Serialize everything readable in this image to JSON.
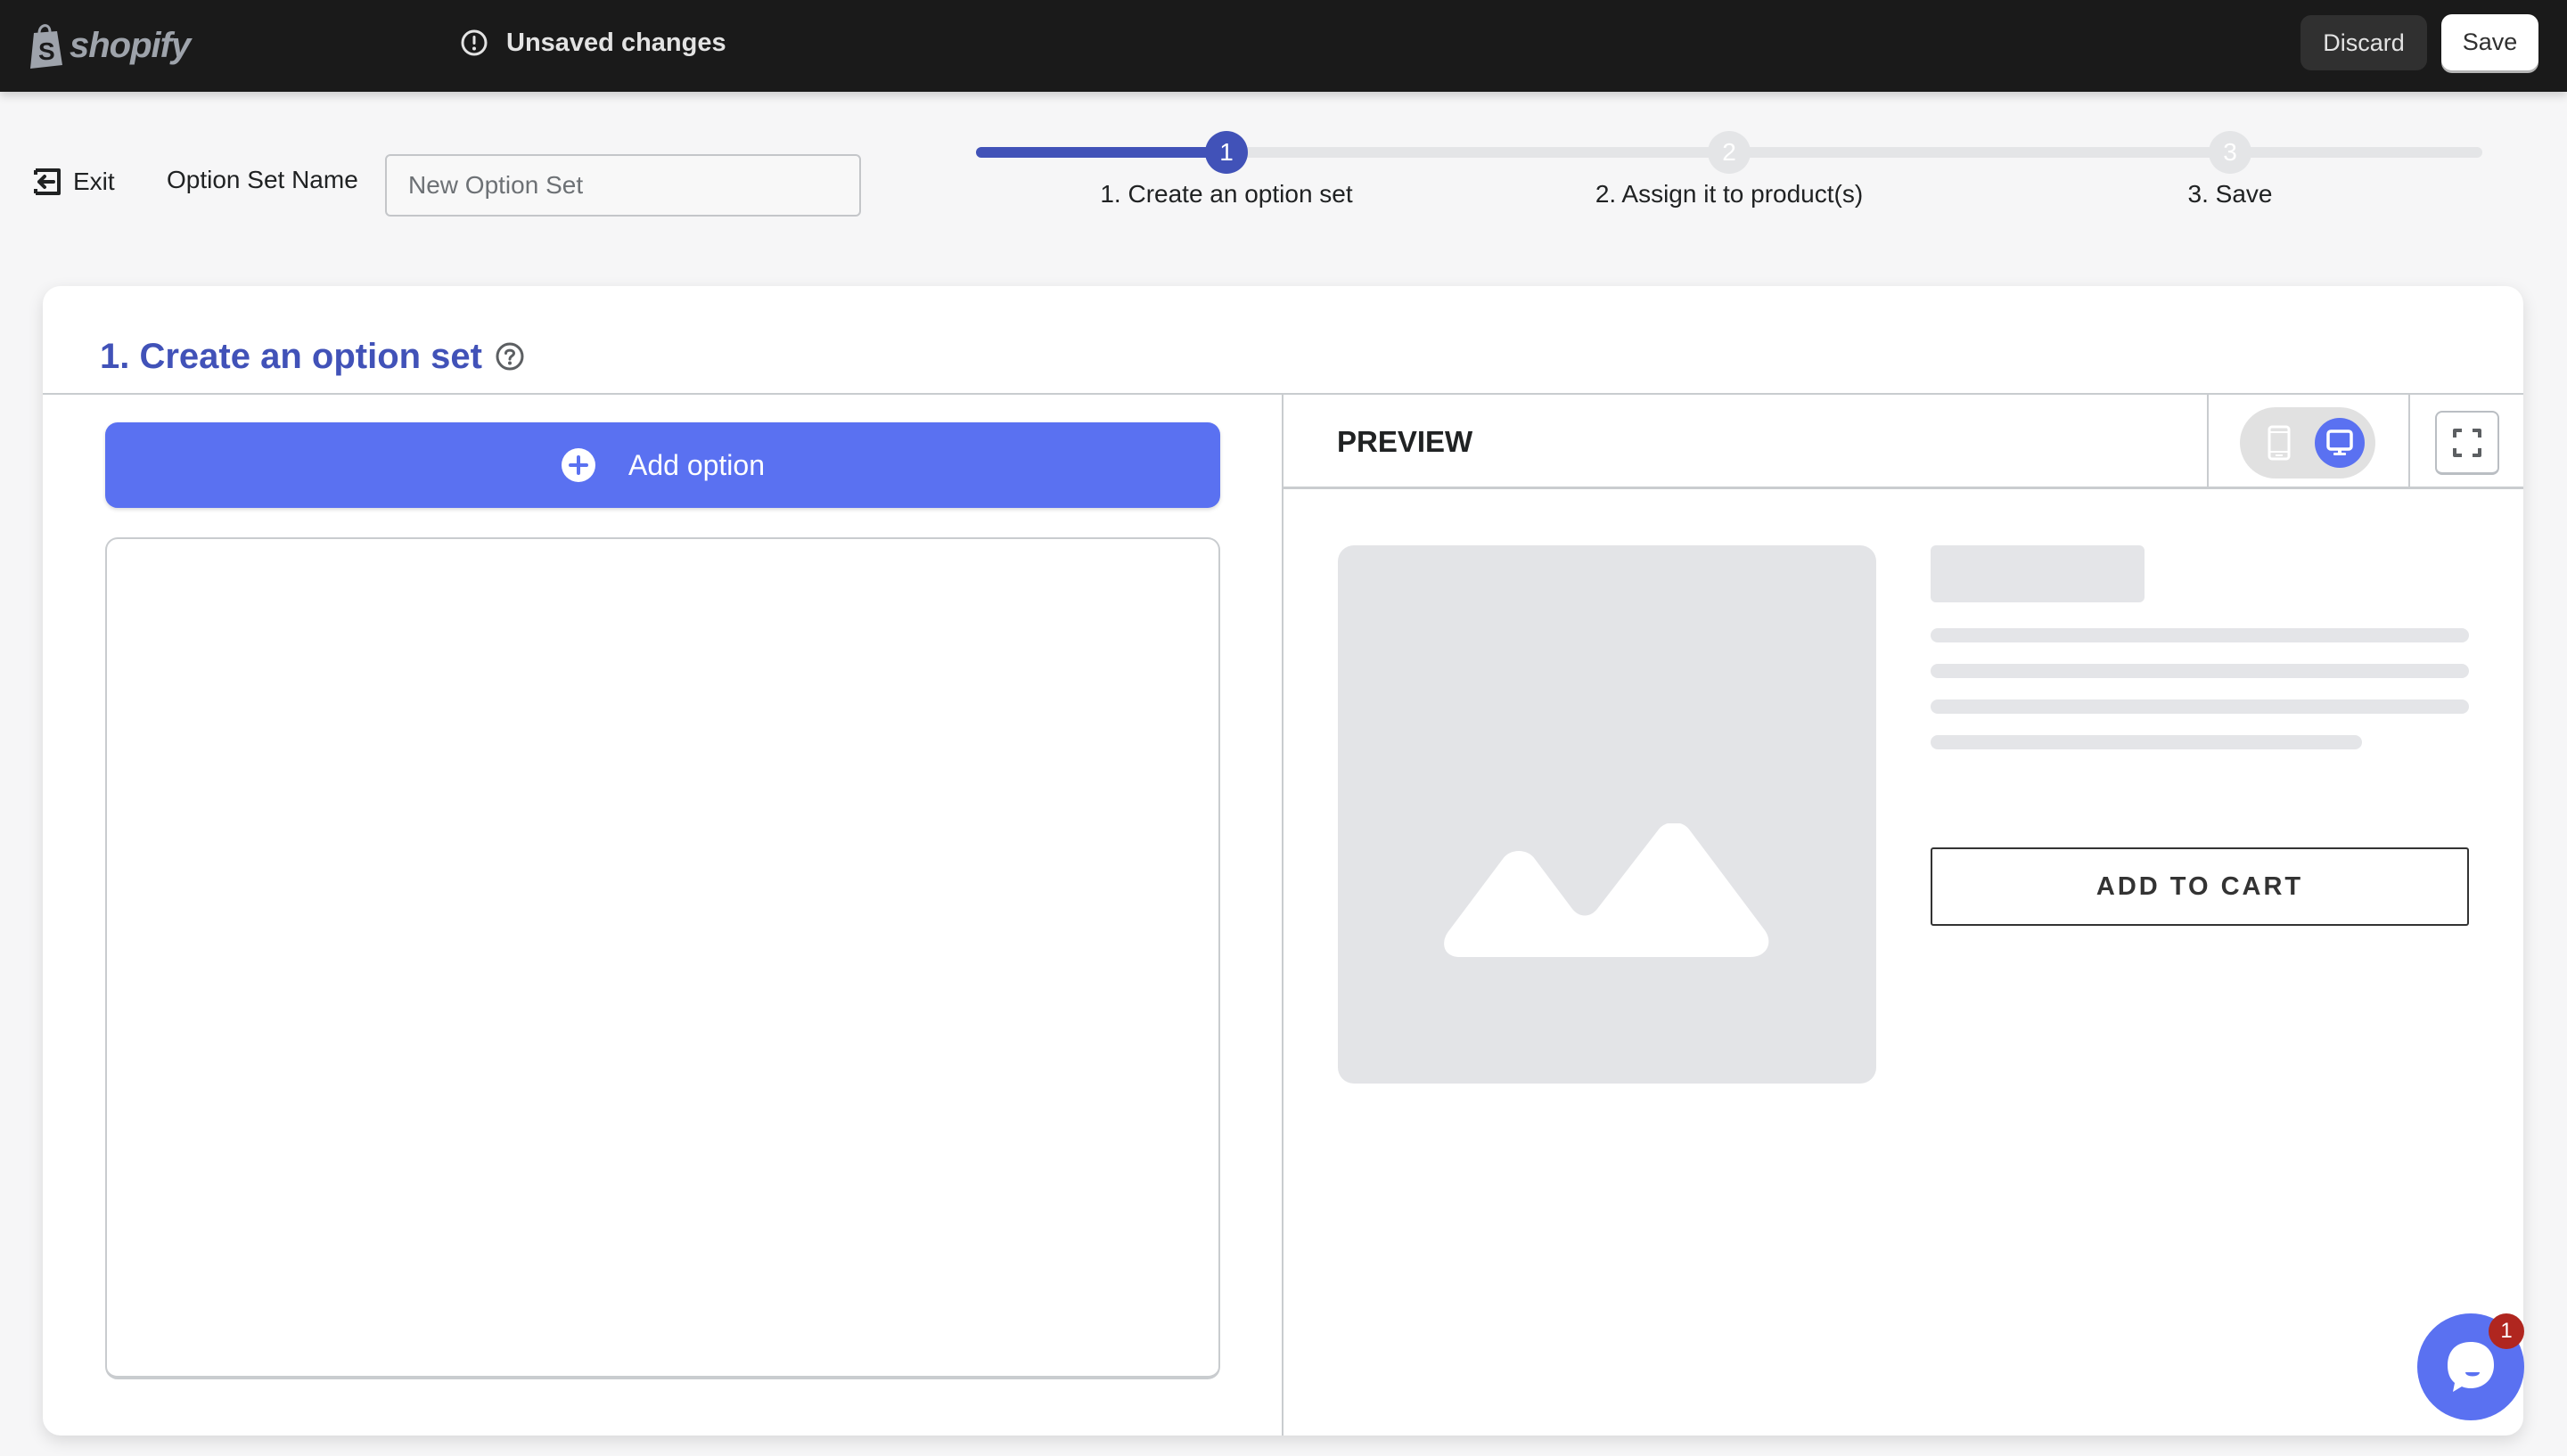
{
  "topbar": {
    "logo_text": "shopify",
    "status_icon": "alert-circle-icon",
    "status_text": "Unsaved changes",
    "discard_label": "Discard",
    "save_label": "Save"
  },
  "subheader": {
    "exit_label": "Exit",
    "exit_icon": "exit-arrow-icon",
    "option_set_name_label": "Option Set Name",
    "option_set_name_value": "",
    "option_set_name_placeholder": "New Option Set"
  },
  "stepper": {
    "progress_fraction": 0.17,
    "steps": [
      {
        "number": "1",
        "label": "1. Create an option set",
        "active": true
      },
      {
        "number": "2",
        "label": "2. Assign it to product(s)",
        "active": false
      },
      {
        "number": "3",
        "label": "3. Save",
        "active": false
      }
    ]
  },
  "card": {
    "title": "1. Create an option set",
    "help_icon": "question-circle-icon",
    "add_option_label": "Add option",
    "add_option_icon": "plus-circle-icon"
  },
  "preview": {
    "title": "PREVIEW",
    "view_modes": [
      {
        "name": "mobile",
        "icon": "mobile-icon",
        "selected": false
      },
      {
        "name": "desktop",
        "icon": "desktop-icon",
        "selected": true
      }
    ],
    "fullscreen_icon": "fullscreen-icon",
    "image_placeholder_icon": "image-placeholder-icon",
    "add_to_cart_label": "ADD TO CART"
  },
  "chat": {
    "icon": "chat-bubble-icon",
    "badge_count": "1"
  },
  "colors": {
    "topbar_bg": "#1a1a1a",
    "accent": "#4152b8",
    "button_blue": "#5a71f1",
    "badge_red": "#b0261f",
    "skeleton": "#e4e5e8"
  }
}
